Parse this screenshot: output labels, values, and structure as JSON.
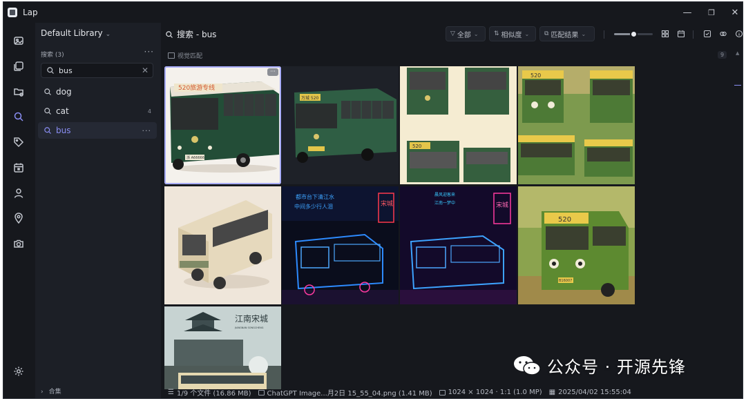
{
  "window": {
    "title": "Lap",
    "controls": [
      "—",
      "❐",
      "✕"
    ]
  },
  "sidebar_rail": [
    "photos-icon",
    "albums-icon",
    "folder-settings-icon",
    "search-icon",
    "tag-icon",
    "calendar-icon",
    "person-icon",
    "location-icon",
    "camera-icon",
    "settings-icon"
  ],
  "library": {
    "name": "Default Library",
    "search_section": "搜索 (3)",
    "search_value": "bus",
    "saved_searches": [
      {
        "label": "dog",
        "count": ""
      },
      {
        "label": "cat",
        "count": "4"
      },
      {
        "label": "bus",
        "count": ""
      }
    ],
    "collection_label": "合集"
  },
  "main": {
    "title": "搜索 - bus",
    "filters": [
      {
        "label": "全部",
        "icon": "filter-icon"
      },
      {
        "label": "相似度",
        "icon": "sort-icon"
      },
      {
        "label": "匹配结果",
        "icon": "match-icon"
      }
    ],
    "zoom_level": 0.5,
    "sub_label": "视觉匹配",
    "result_count": "9",
    "accent_color": "#8b8ff5"
  },
  "thumbnails": [
    {
      "id": "bus-green-white",
      "selected": true,
      "sign_text": "520旅游专线",
      "plate": "浙 A66666"
    },
    {
      "id": "bus-green-dark",
      "selected": false,
      "sign_text": "万城 520",
      "plate": "浙 A66A"
    },
    {
      "id": "bus-green-sheet",
      "selected": false,
      "sign_text": "520",
      "plate": ""
    },
    {
      "id": "bus-cartoon-trees",
      "selected": false,
      "sign_text": "520",
      "plate": ""
    },
    {
      "id": "bus-beige-3d",
      "selected": false,
      "sign_text": "",
      "plate": ""
    },
    {
      "id": "bus-neon-blue",
      "selected": false,
      "sign_text": "宋城",
      "plate": ""
    },
    {
      "id": "bus-neon-red",
      "selected": false,
      "sign_text": "宋城",
      "plate": ""
    },
    {
      "id": "bus-cartoon-street",
      "selected": false,
      "sign_text": "520",
      "plate": "B16007"
    },
    {
      "id": "poster-jiangnan",
      "selected": false,
      "sign_text": "江南宋城",
      "plate": "JIANGNAN SONGCHENG"
    }
  ],
  "status": {
    "files": "1/9 个文件 (16.86 MB)",
    "filename": "ChatGPT Image...月2日 15_55_04.png (1.41 MB)",
    "dimensions": "1024 × 1024 · 1:1 (1.0 MP)",
    "date": "2025/04/02 15:55:04"
  },
  "watermark": "公众号 · 开源先锋"
}
